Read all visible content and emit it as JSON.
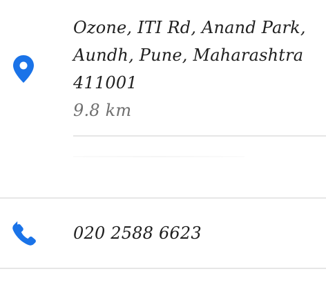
{
  "address": {
    "line1": "Ozone, ITI Rd, Anand Park,",
    "line2": "Aundh, Pune, Maharashtra",
    "line3": "411001",
    "distance": "9.8 km",
    "icon": "location-pin-icon",
    "icon_color": "#1a73e8"
  },
  "phone": {
    "number": "020 2588 6623",
    "icon": "phone-icon",
    "icon_color": "#1a73e8"
  }
}
